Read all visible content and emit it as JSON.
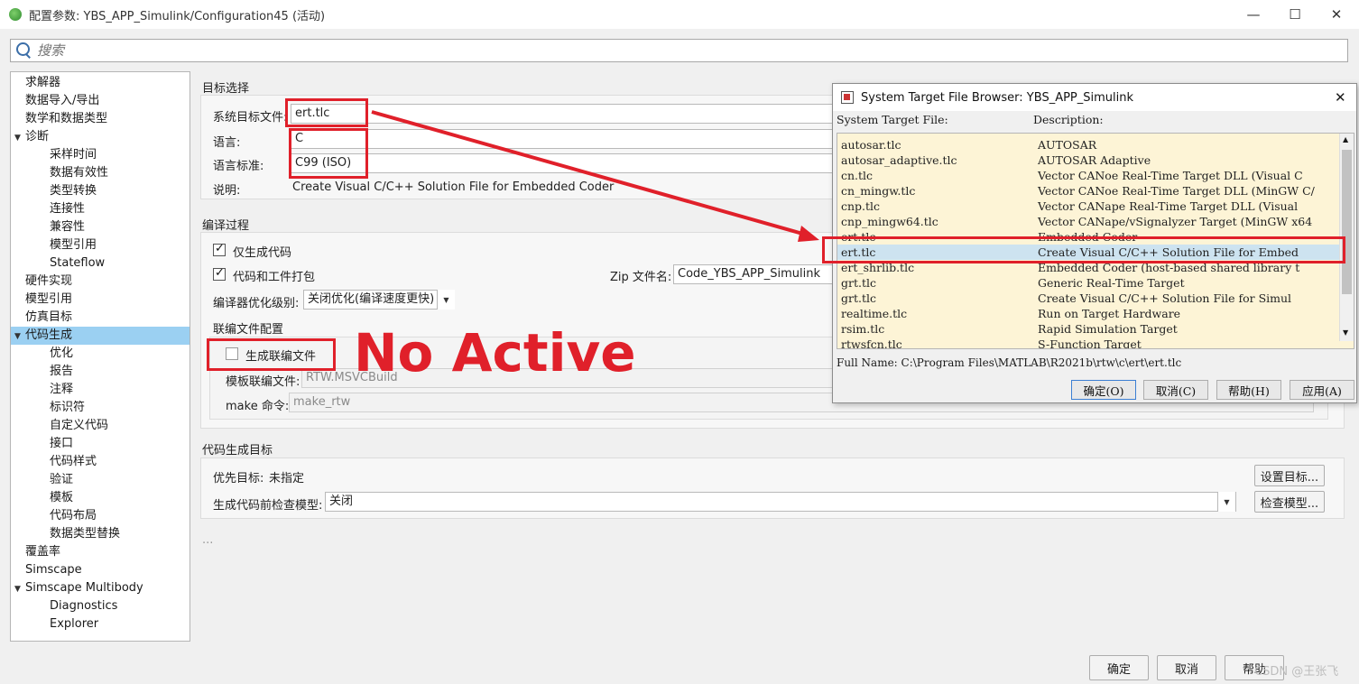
{
  "window": {
    "title": "配置参数: YBS_APP_Simulink/Configuration45 (活动)",
    "minimize": "—",
    "maximize": "☐",
    "close": "✕"
  },
  "search": {
    "placeholder": "搜索"
  },
  "tree": {
    "items": [
      {
        "label": "求解器",
        "level": 0,
        "arrow": ""
      },
      {
        "label": "数据导入/导出",
        "level": 0,
        "arrow": ""
      },
      {
        "label": "数学和数据类型",
        "level": 0,
        "arrow": ""
      },
      {
        "label": "诊断",
        "level": 0,
        "arrow": "▼"
      },
      {
        "label": "采样时间",
        "level": 1,
        "arrow": ""
      },
      {
        "label": "数据有效性",
        "level": 1,
        "arrow": ""
      },
      {
        "label": "类型转换",
        "level": 1,
        "arrow": ""
      },
      {
        "label": "连接性",
        "level": 1,
        "arrow": ""
      },
      {
        "label": "兼容性",
        "level": 1,
        "arrow": ""
      },
      {
        "label": "模型引用",
        "level": 1,
        "arrow": ""
      },
      {
        "label": "Stateflow",
        "level": 1,
        "arrow": ""
      },
      {
        "label": "硬件实现",
        "level": 0,
        "arrow": ""
      },
      {
        "label": "模型引用",
        "level": 0,
        "arrow": ""
      },
      {
        "label": "仿真目标",
        "level": 0,
        "arrow": ""
      },
      {
        "label": "代码生成",
        "level": 0,
        "arrow": "▼",
        "selected": true
      },
      {
        "label": "优化",
        "level": 1,
        "arrow": ""
      },
      {
        "label": "报告",
        "level": 1,
        "arrow": ""
      },
      {
        "label": "注释",
        "level": 1,
        "arrow": ""
      },
      {
        "label": "标识符",
        "level": 1,
        "arrow": ""
      },
      {
        "label": "自定义代码",
        "level": 1,
        "arrow": ""
      },
      {
        "label": "接口",
        "level": 1,
        "arrow": ""
      },
      {
        "label": "代码样式",
        "level": 1,
        "arrow": ""
      },
      {
        "label": "验证",
        "level": 1,
        "arrow": ""
      },
      {
        "label": "模板",
        "level": 1,
        "arrow": ""
      },
      {
        "label": "代码布局",
        "level": 1,
        "arrow": ""
      },
      {
        "label": "数据类型替换",
        "level": 1,
        "arrow": ""
      },
      {
        "label": "覆盖率",
        "level": 0,
        "arrow": ""
      },
      {
        "label": "Simscape",
        "level": 0,
        "arrow": ""
      },
      {
        "label": "Simscape Multibody",
        "level": 0,
        "arrow": "▼"
      },
      {
        "label": "Diagnostics",
        "level": 1,
        "arrow": ""
      },
      {
        "label": "Explorer",
        "level": 1,
        "arrow": ""
      }
    ]
  },
  "target": {
    "section": "目标选择",
    "stf_label": "系统目标文件:",
    "stf_value": "ert.tlc",
    "lang_label": "语言:",
    "lang_value": "C",
    "std_label": "语言标准:",
    "std_value": "C99 (ISO)",
    "desc_label": "说明:",
    "desc_value": "Create Visual C/C++ Solution File for Embedded Coder"
  },
  "build": {
    "section": "编译过程",
    "gen_only": "仅生成代码",
    "pack": "代码和工件打包",
    "zip_label": "Zip 文件名:",
    "zip_value": "Code_YBS_APP_Simulink",
    "opt_label": "编译器优化级别:",
    "opt_value": "关闭优化(编译速度更快)",
    "mk_section": "联编文件配置",
    "gen_makefile": "生成联编文件",
    "tmf_label": "模板联编文件:",
    "tmf_value": "RTW.MSVCBuild",
    "make_label": "make 命令:",
    "make_value": "make_rtw"
  },
  "cgtarget": {
    "section": "代码生成目标",
    "prio_label": "优先目标:",
    "prio_value": "未指定",
    "set_btn": "设置目标...",
    "check_label": "生成代码前检查模型:",
    "check_value": "关闭",
    "check_btn": "检查模型..."
  },
  "ellipsis": "...",
  "annotation": "No Active",
  "dialog": {
    "title": "System Target File Browser: YBS_APP_Simulink",
    "col1": "System Target File:",
    "col2": "Description:",
    "rows": [
      {
        "file": "autosar.tlc",
        "desc": "AUTOSAR"
      },
      {
        "file": "autosar_adaptive.tlc",
        "desc": "AUTOSAR Adaptive"
      },
      {
        "file": "cn.tlc",
        "desc": "Vector CANoe Real-Time Target DLL (Visual C"
      },
      {
        "file": "cn_mingw.tlc",
        "desc": "Vector CANoe Real-Time Target DLL (MinGW C/"
      },
      {
        "file": "cnp.tlc",
        "desc": "Vector CANape Real-Time Target DLL (Visual"
      },
      {
        "file": "cnp_mingw64.tlc",
        "desc": "Vector CANape/vSignalyzer Target (MinGW x64"
      },
      {
        "file": "ert.tlc",
        "desc": "Embedded Coder"
      },
      {
        "file": "ert.tlc",
        "desc": "Create Visual C/C++ Solution File for Embed",
        "selected": true
      },
      {
        "file": "ert_shrlib.tlc",
        "desc": "Embedded Coder (host-based shared library t"
      },
      {
        "file": "grt.tlc",
        "desc": "Generic Real-Time Target"
      },
      {
        "file": "grt.tlc",
        "desc": "Create Visual C/C++ Solution File for Simul"
      },
      {
        "file": "realtime.tlc",
        "desc": "Run on Target Hardware"
      },
      {
        "file": "rsim.tlc",
        "desc": "Rapid Simulation Target"
      },
      {
        "file": "rtwsfcn.tlc",
        "desc": "S-Function Target"
      }
    ],
    "fullname": "Full Name: C:\\Program Files\\MATLAB\\R2021b\\rtw\\c\\ert\\ert.tlc",
    "ok": "确定(O)",
    "cancel": "取消(C)",
    "help": "帮助(H)",
    "apply": "应用(A)",
    "close": "✕"
  },
  "footer": {
    "ok": "确定",
    "cancel": "取消",
    "help": "帮助"
  },
  "watermark": "CSDN @王张飞",
  "colors": {
    "annotation_red": "#e0202a",
    "selection_blue": "#9bd0f2",
    "list_bg": "#fdf4d6"
  }
}
